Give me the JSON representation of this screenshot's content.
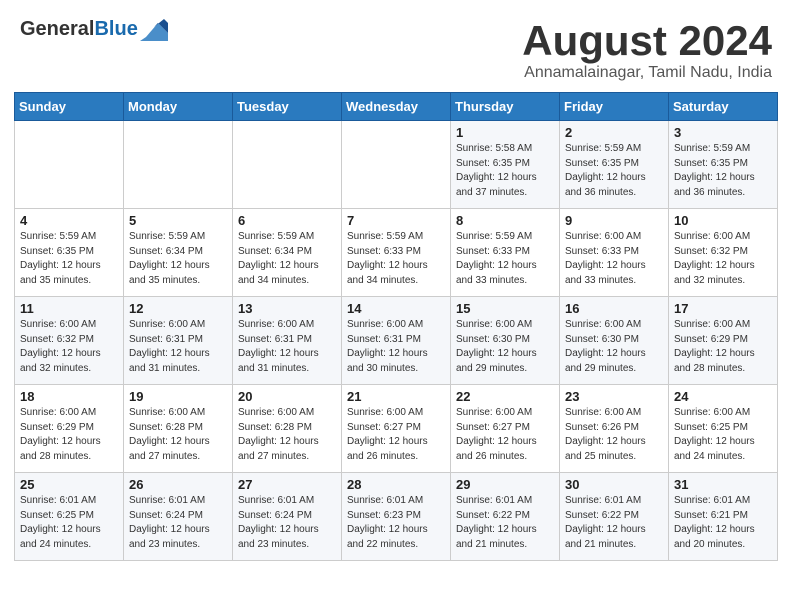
{
  "logo": {
    "general": "General",
    "blue": "Blue"
  },
  "header": {
    "month": "August 2024",
    "location": "Annamalainagar, Tamil Nadu, India"
  },
  "days_of_week": [
    "Sunday",
    "Monday",
    "Tuesday",
    "Wednesday",
    "Thursday",
    "Friday",
    "Saturday"
  ],
  "weeks": [
    [
      {
        "day": "",
        "info": ""
      },
      {
        "day": "",
        "info": ""
      },
      {
        "day": "",
        "info": ""
      },
      {
        "day": "",
        "info": ""
      },
      {
        "day": "1",
        "info": "Sunrise: 5:58 AM\nSunset: 6:35 PM\nDaylight: 12 hours\nand 37 minutes."
      },
      {
        "day": "2",
        "info": "Sunrise: 5:59 AM\nSunset: 6:35 PM\nDaylight: 12 hours\nand 36 minutes."
      },
      {
        "day": "3",
        "info": "Sunrise: 5:59 AM\nSunset: 6:35 PM\nDaylight: 12 hours\nand 36 minutes."
      }
    ],
    [
      {
        "day": "4",
        "info": "Sunrise: 5:59 AM\nSunset: 6:35 PM\nDaylight: 12 hours\nand 35 minutes."
      },
      {
        "day": "5",
        "info": "Sunrise: 5:59 AM\nSunset: 6:34 PM\nDaylight: 12 hours\nand 35 minutes."
      },
      {
        "day": "6",
        "info": "Sunrise: 5:59 AM\nSunset: 6:34 PM\nDaylight: 12 hours\nand 34 minutes."
      },
      {
        "day": "7",
        "info": "Sunrise: 5:59 AM\nSunset: 6:33 PM\nDaylight: 12 hours\nand 34 minutes."
      },
      {
        "day": "8",
        "info": "Sunrise: 5:59 AM\nSunset: 6:33 PM\nDaylight: 12 hours\nand 33 minutes."
      },
      {
        "day": "9",
        "info": "Sunrise: 6:00 AM\nSunset: 6:33 PM\nDaylight: 12 hours\nand 33 minutes."
      },
      {
        "day": "10",
        "info": "Sunrise: 6:00 AM\nSunset: 6:32 PM\nDaylight: 12 hours\nand 32 minutes."
      }
    ],
    [
      {
        "day": "11",
        "info": "Sunrise: 6:00 AM\nSunset: 6:32 PM\nDaylight: 12 hours\nand 32 minutes."
      },
      {
        "day": "12",
        "info": "Sunrise: 6:00 AM\nSunset: 6:31 PM\nDaylight: 12 hours\nand 31 minutes."
      },
      {
        "day": "13",
        "info": "Sunrise: 6:00 AM\nSunset: 6:31 PM\nDaylight: 12 hours\nand 31 minutes."
      },
      {
        "day": "14",
        "info": "Sunrise: 6:00 AM\nSunset: 6:31 PM\nDaylight: 12 hours\nand 30 minutes."
      },
      {
        "day": "15",
        "info": "Sunrise: 6:00 AM\nSunset: 6:30 PM\nDaylight: 12 hours\nand 29 minutes."
      },
      {
        "day": "16",
        "info": "Sunrise: 6:00 AM\nSunset: 6:30 PM\nDaylight: 12 hours\nand 29 minutes."
      },
      {
        "day": "17",
        "info": "Sunrise: 6:00 AM\nSunset: 6:29 PM\nDaylight: 12 hours\nand 28 minutes."
      }
    ],
    [
      {
        "day": "18",
        "info": "Sunrise: 6:00 AM\nSunset: 6:29 PM\nDaylight: 12 hours\nand 28 minutes."
      },
      {
        "day": "19",
        "info": "Sunrise: 6:00 AM\nSunset: 6:28 PM\nDaylight: 12 hours\nand 27 minutes."
      },
      {
        "day": "20",
        "info": "Sunrise: 6:00 AM\nSunset: 6:28 PM\nDaylight: 12 hours\nand 27 minutes."
      },
      {
        "day": "21",
        "info": "Sunrise: 6:00 AM\nSunset: 6:27 PM\nDaylight: 12 hours\nand 26 minutes."
      },
      {
        "day": "22",
        "info": "Sunrise: 6:00 AM\nSunset: 6:27 PM\nDaylight: 12 hours\nand 26 minutes."
      },
      {
        "day": "23",
        "info": "Sunrise: 6:00 AM\nSunset: 6:26 PM\nDaylight: 12 hours\nand 25 minutes."
      },
      {
        "day": "24",
        "info": "Sunrise: 6:00 AM\nSunset: 6:25 PM\nDaylight: 12 hours\nand 24 minutes."
      }
    ],
    [
      {
        "day": "25",
        "info": "Sunrise: 6:01 AM\nSunset: 6:25 PM\nDaylight: 12 hours\nand 24 minutes."
      },
      {
        "day": "26",
        "info": "Sunrise: 6:01 AM\nSunset: 6:24 PM\nDaylight: 12 hours\nand 23 minutes."
      },
      {
        "day": "27",
        "info": "Sunrise: 6:01 AM\nSunset: 6:24 PM\nDaylight: 12 hours\nand 23 minutes."
      },
      {
        "day": "28",
        "info": "Sunrise: 6:01 AM\nSunset: 6:23 PM\nDaylight: 12 hours\nand 22 minutes."
      },
      {
        "day": "29",
        "info": "Sunrise: 6:01 AM\nSunset: 6:22 PM\nDaylight: 12 hours\nand 21 minutes."
      },
      {
        "day": "30",
        "info": "Sunrise: 6:01 AM\nSunset: 6:22 PM\nDaylight: 12 hours\nand 21 minutes."
      },
      {
        "day": "31",
        "info": "Sunrise: 6:01 AM\nSunset: 6:21 PM\nDaylight: 12 hours\nand 20 minutes."
      }
    ]
  ]
}
